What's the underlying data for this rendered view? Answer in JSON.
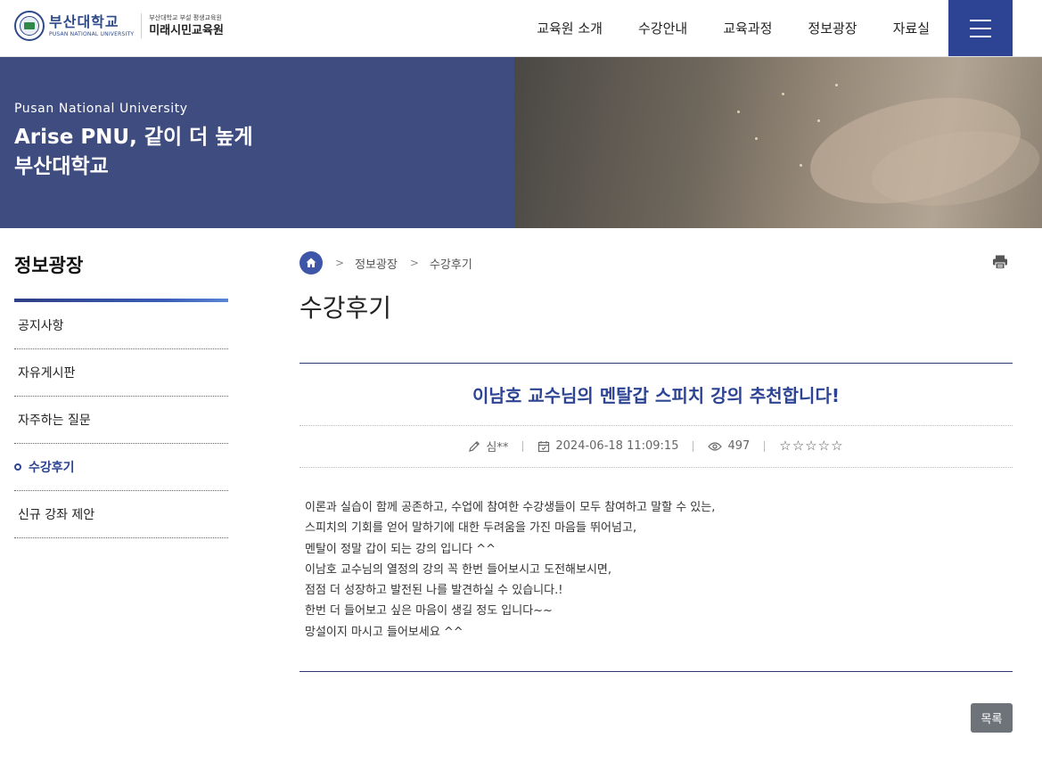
{
  "header": {
    "logo": {
      "name_ko": "부산대학교",
      "name_en": "PUSAN NATIONAL UNIVERSITY",
      "sub_small": "부산대학교 부설 평생교육원",
      "sub_big": "미래시민교육원"
    },
    "nav": [
      "교육원 소개",
      "수강안내",
      "교육과정",
      "정보광장",
      "자료실"
    ],
    "menu_icon": "hamburger-icon"
  },
  "hero": {
    "subtitle": "Pusan National University",
    "title_line1": "Arise PNU, 같이 더 높게",
    "title_line2": "부산대학교"
  },
  "sidebar": {
    "title": "정보광장",
    "items": [
      {
        "label": "공지사항",
        "active": false
      },
      {
        "label": "자유게시판",
        "active": false
      },
      {
        "label": "자주하는 질문",
        "active": false
      },
      {
        "label": "수강후기",
        "active": true
      },
      {
        "label": "신규 강좌 제안",
        "active": false
      }
    ]
  },
  "breadcrumb": {
    "home_icon": "home-icon",
    "items": [
      "정보광장",
      "수강후기"
    ]
  },
  "page_title": "수강후기",
  "post": {
    "title": "이남호 교수님의 멘탈갑 스피치 강의 추천합니다!",
    "author": "심**",
    "date": "2024-06-18 11:09:15",
    "views": "497",
    "rating": 0,
    "rating_max": 5,
    "body": [
      "이론과 실습이 함께 공존하고, 수업에 참여한 수강생들이 모두 참여하고 말할 수 있는,",
      "스피치의 기회를 얻어 말하기에 대한 두려움을 가진 마음들 뛰어넘고,",
      "멘탈이 정말 갑이 되는 강의 입니다 ^^",
      "이남호 교수님의 열정의 강의 꼭 한번 들어보시고 도전해보시면,",
      "점점 더 성장하고 발전된 나를 발견하실 수 있습니다.!",
      "한번 더 들어보고 싶은 마음이 생길 정도 입니다~~",
      "망설이지 마시고 들어보세요 ^^"
    ]
  },
  "buttons": {
    "list": "목록"
  },
  "colors": {
    "brand": "#2d4494",
    "hero_panel": "#3f4c7f",
    "button_gray": "#6e737a"
  }
}
